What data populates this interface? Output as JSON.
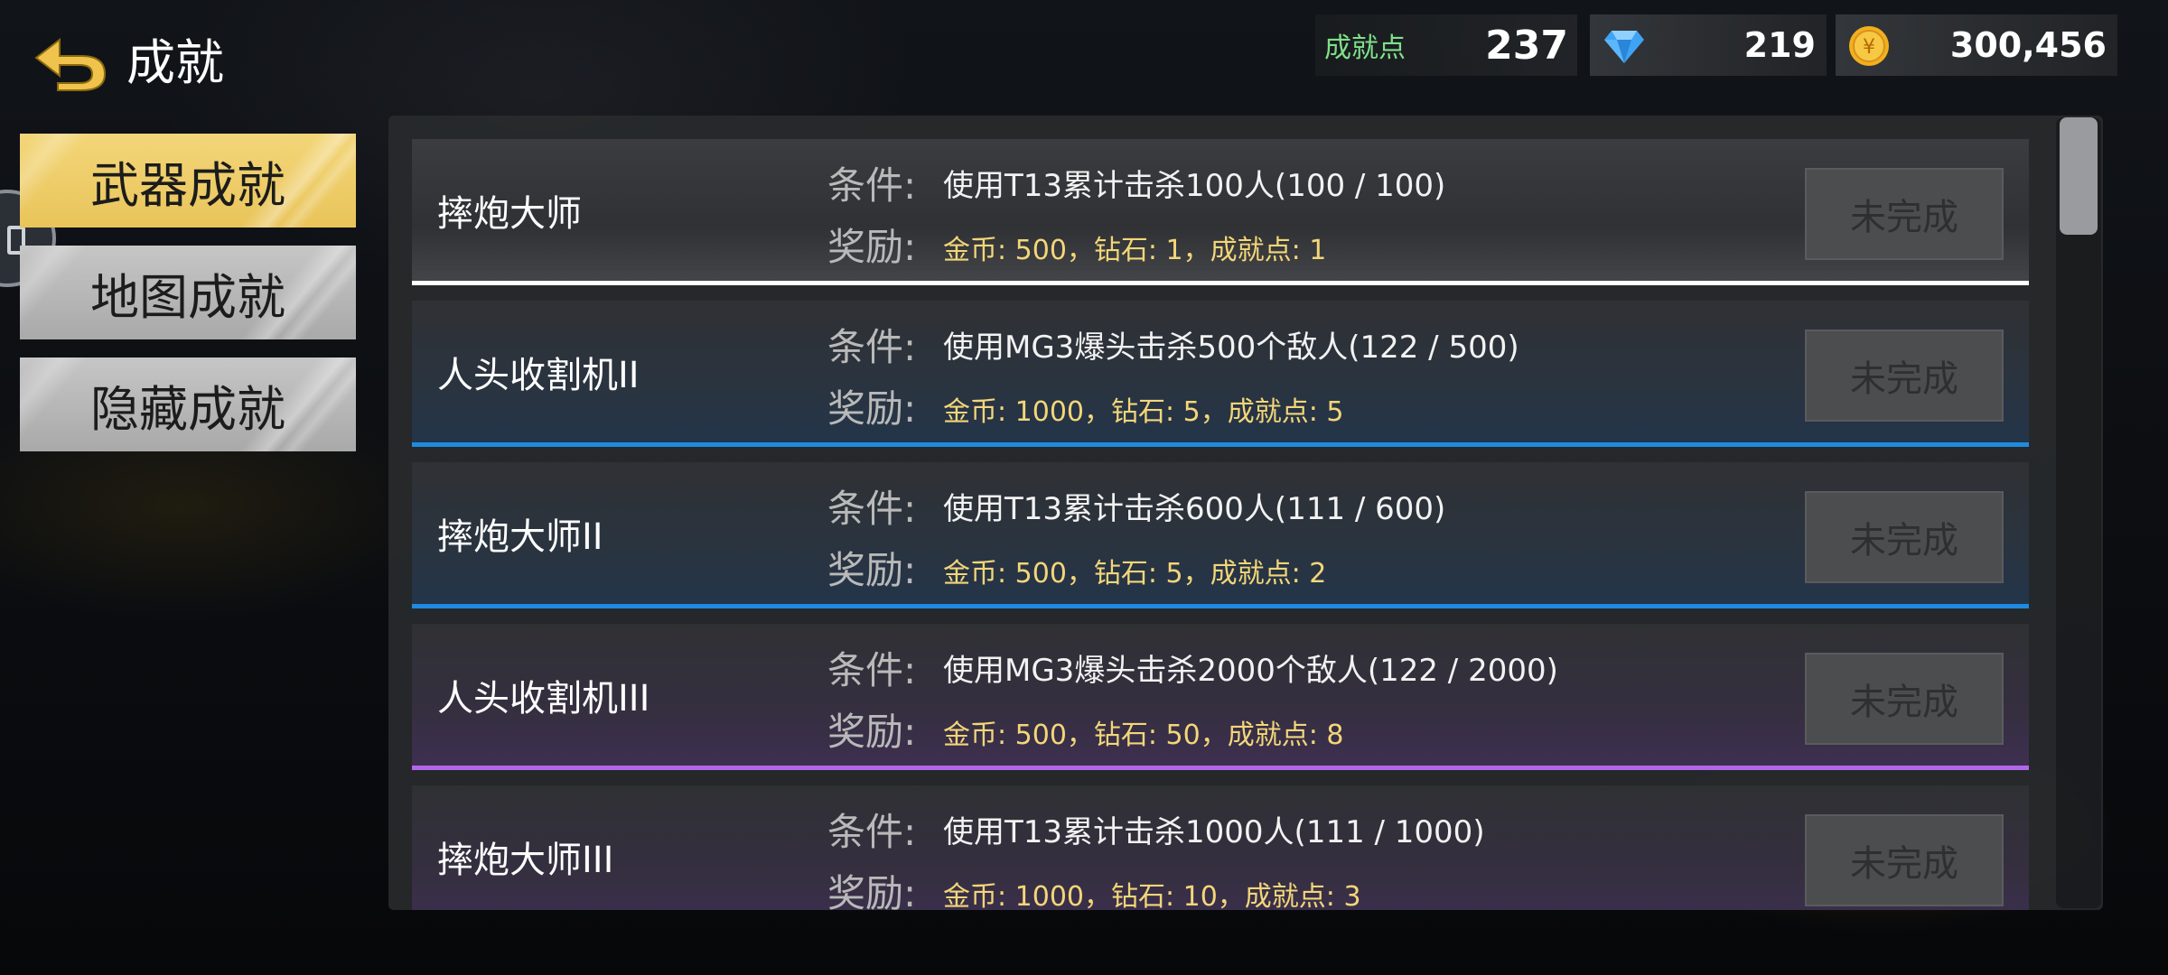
{
  "header": {
    "title": "成就",
    "back_icon": "back-arrow-icon"
  },
  "stats": {
    "points_label": "成就点",
    "points_value": "237",
    "diamond_icon": "diamond-icon",
    "diamond_value": "219",
    "coin_icon": "gold-coin-icon",
    "coin_symbol": "¥",
    "coin_value": "300,456"
  },
  "tabs": [
    {
      "label": "武器成就",
      "active": true
    },
    {
      "label": "地图成就",
      "active": false
    },
    {
      "label": "隐藏成就",
      "active": false
    }
  ],
  "labels": {
    "condition": "条件:",
    "reward": "奖励:"
  },
  "achievements": [
    {
      "name": "摔炮大师",
      "condition": "使用T13累计击杀100人(100 / 100)",
      "reward": "金币: 500，钻石: 1，成就点: 1",
      "status": "未完成",
      "tier": "white"
    },
    {
      "name": "人头收割机II",
      "condition": "使用MG3爆头击杀500个敌人(122 / 500)",
      "reward": "金币: 1000，钻石: 5，成就点: 5",
      "status": "未完成",
      "tier": "blue"
    },
    {
      "name": "摔炮大师II",
      "condition": "使用T13累计击杀600人(111 / 600)",
      "reward": "金币: 500，钻石: 5，成就点: 2",
      "status": "未完成",
      "tier": "blue"
    },
    {
      "name": "人头收割机III",
      "condition": "使用MG3爆头击杀2000个敌人(122 / 2000)",
      "reward": "金币: 500，钻石: 50，成就点: 8",
      "status": "未完成",
      "tier": "purple"
    },
    {
      "name": "摔炮大师III",
      "condition": "使用T13累计击杀1000人(111 / 1000)",
      "reward": "金币: 1000，钻石: 10，成就点: 3",
      "status": "未完成",
      "tier": "purple"
    }
  ],
  "colors": {
    "active_tab": "#f0cf6a",
    "reward_text": "#f3d679",
    "points_label": "#7fe08a",
    "tier_white": "#ffffff",
    "tier_blue": "#1f8be0",
    "tier_purple": "#b267ea"
  }
}
